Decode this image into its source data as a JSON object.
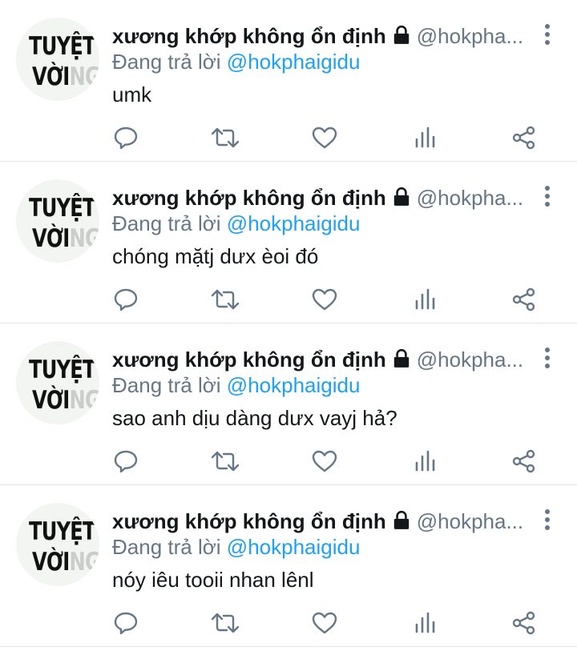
{
  "avatar": {
    "line1": "TUYỆT",
    "line2_main": "VỜI",
    "line2_fade": "NG"
  },
  "tweets": [
    {
      "name": "xương khớp không ổn định",
      "handle": "@hokpha...",
      "reply_prefix": "Đang trả lời",
      "reply_handle": "@hokphaigidu",
      "text": "umk"
    },
    {
      "name": "xương khớp không ổn định",
      "handle": "@hokpha...",
      "reply_prefix": "Đang trả lời",
      "reply_handle": "@hokphaigidu",
      "text": "chóng mặtj dưx èoi đó"
    },
    {
      "name": "xương khớp không ổn định",
      "handle": "@hokpha...",
      "reply_prefix": "Đang trả lời",
      "reply_handle": "@hokphaigidu",
      "text": "sao anh dịu dàng dưx vayj hả?"
    },
    {
      "name": "xương khớp không ổn định",
      "handle": "@hokpha...",
      "reply_prefix": "Đang trả lời",
      "reply_handle": "@hokphaigidu",
      "text": "nóy iêu tooii nhan lênl"
    }
  ],
  "icons": {
    "lock": "lock-icon",
    "more": "more-vertical-icon",
    "reply": "reply-icon",
    "retweet": "retweet-icon",
    "like": "heart-icon",
    "stats": "stats-icon",
    "share": "share-icon"
  },
  "colors": {
    "text": "#14171a",
    "secondary": "#657786",
    "link": "#1da1f2",
    "divider": "#e1e8ed"
  }
}
